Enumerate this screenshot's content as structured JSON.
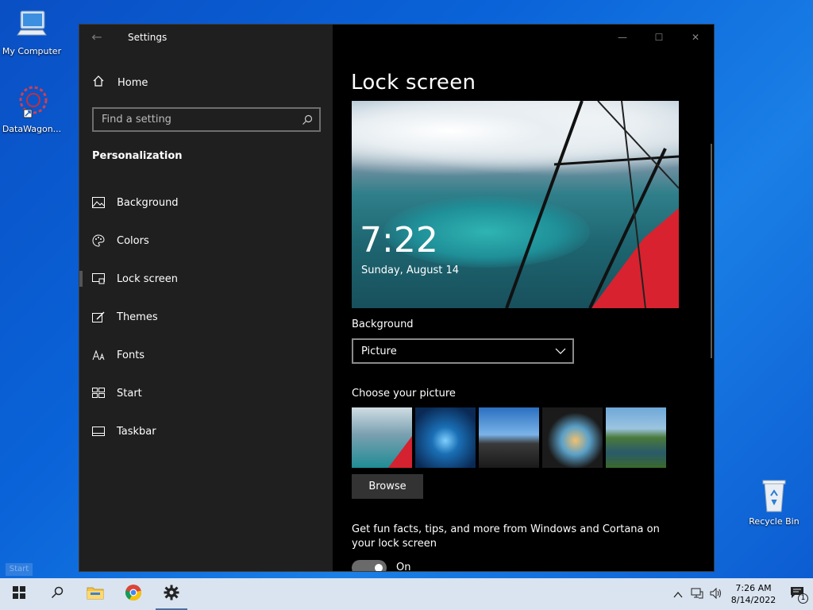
{
  "desktop": {
    "icons": [
      {
        "label": "My Computer"
      },
      {
        "label": "DataWagon..."
      },
      {
        "label": "Recycle Bin"
      }
    ],
    "start_hint": "Start"
  },
  "window": {
    "app_title": "Settings",
    "back_glyph": "←",
    "controls": {
      "minimize": "—",
      "maximize": "☐",
      "close": "✕"
    }
  },
  "sidebar": {
    "home_label": "Home",
    "search_placeholder": "Find a setting",
    "section_title": "Personalization",
    "items": [
      {
        "label": "Background",
        "icon": "image-icon"
      },
      {
        "label": "Colors",
        "icon": "palette-icon"
      },
      {
        "label": "Lock screen",
        "icon": "lock-screen-icon",
        "active": true
      },
      {
        "label": "Themes",
        "icon": "themes-icon"
      },
      {
        "label": "Fonts",
        "icon": "fonts-icon"
      },
      {
        "label": "Start",
        "icon": "start-icon"
      },
      {
        "label": "Taskbar",
        "icon": "taskbar-icon"
      }
    ]
  },
  "main": {
    "title": "Lock screen",
    "preview": {
      "time": "7:22",
      "date": "Sunday, August 14"
    },
    "background_label": "Background",
    "background_value": "Picture",
    "choose_label": "Choose your picture",
    "browse_label": "Browse",
    "facts_text": "Get fun facts, tips, and more from Windows and Cortana on your lock screen",
    "toggle_label": "On",
    "toggle_on": true
  },
  "taskbar": {
    "time": "7:26 AM",
    "date": "8/14/2022",
    "notification_count": "1"
  },
  "colors": {
    "sidebar_bg": "#1f1f1f",
    "content_bg": "#000000",
    "wing_red": "#d9222f",
    "taskbar_bg": "#d9e4f0"
  }
}
